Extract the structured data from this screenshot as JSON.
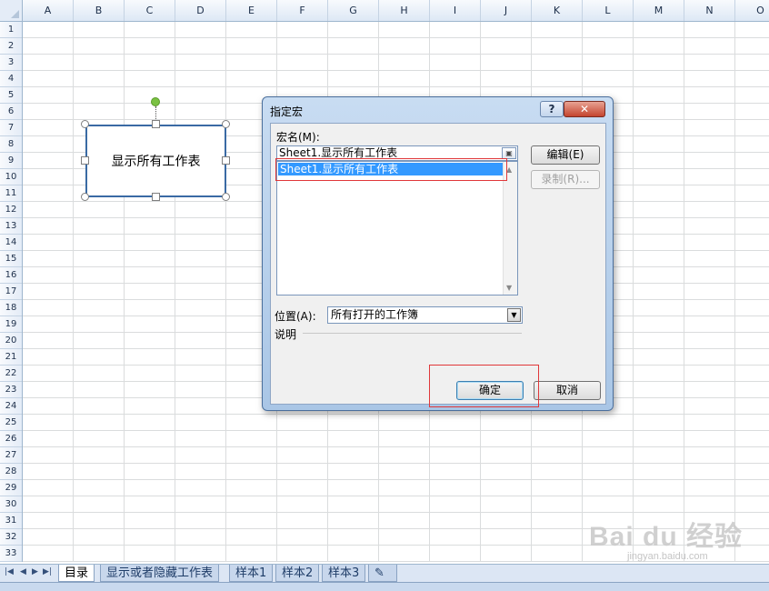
{
  "columns": [
    "A",
    "B",
    "C",
    "D",
    "E",
    "F",
    "G",
    "H",
    "I",
    "J",
    "K",
    "L",
    "M",
    "N",
    "O"
  ],
  "rows": [
    "1",
    "2",
    "3",
    "4",
    "5",
    "6",
    "7",
    "8",
    "9",
    "10",
    "11",
    "12",
    "13",
    "14",
    "15",
    "16",
    "17",
    "18",
    "19",
    "20",
    "21",
    "22",
    "23",
    "24",
    "25",
    "26",
    "27",
    "28",
    "29",
    "30",
    "31",
    "32",
    "33"
  ],
  "shape": {
    "text": "显示所有工作表"
  },
  "dialog": {
    "title": "指定宏",
    "help_label": "?",
    "close_label": "✕",
    "macro_name_label": "宏名(M):",
    "macro_name_value": "Sheet1.显示所有工作表",
    "macro_list": [
      "Sheet1.显示所有工作表"
    ],
    "edit_label": "编辑(E)",
    "record_label": "录制(R)...",
    "location_label": "位置(A):",
    "location_value": "所有打开的工作簿",
    "description_label": "说明",
    "ok_label": "确定",
    "cancel_label": "取消"
  },
  "sheet_tabs": [
    "目录",
    "显示或者隐藏工作表",
    "样本1",
    "样本2",
    "样本3"
  ],
  "active_tab": "目录",
  "watermark": {
    "brand": "Bai du 经验",
    "url": "jingyan.baidu.com"
  },
  "colors": {
    "accent": "#3399ff",
    "highlight_box": "#e0383a",
    "rotation_handle": "#7ac142"
  }
}
